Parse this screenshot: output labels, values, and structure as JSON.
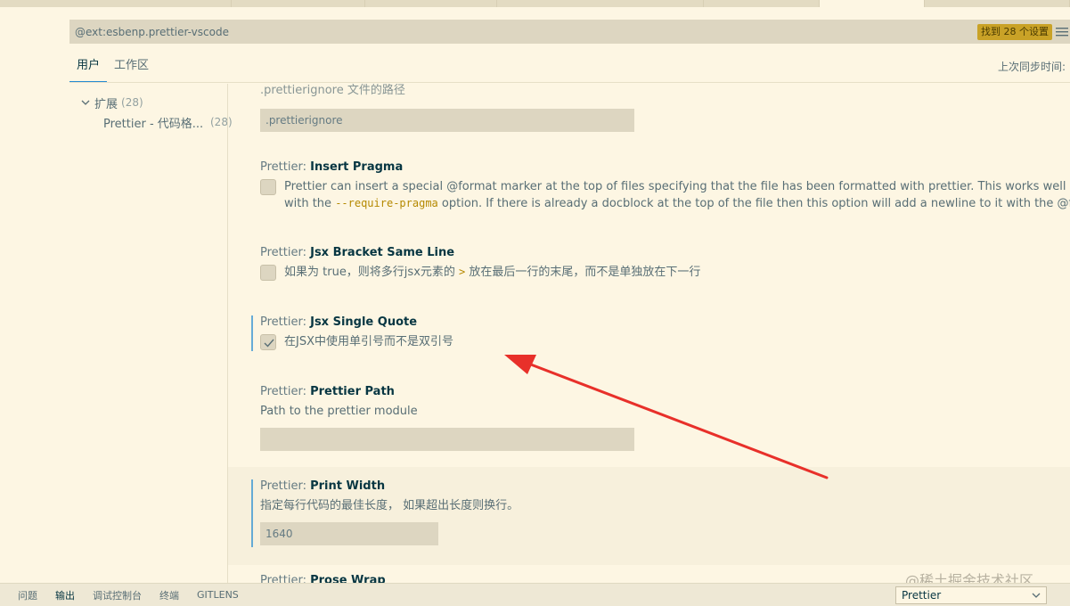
{
  "search": {
    "value": "@ext:esbenp.prettier-vscode",
    "result_count": "找到 28 个设置"
  },
  "scope_tabs": [
    "用户",
    "工作区"
  ],
  "sync_label": "上次同步时间:",
  "toc": {
    "group_label": "扩展",
    "group_count": "(28)",
    "item_label": "Prettier - 代码格...",
    "item_count": "(28)"
  },
  "settings": {
    "ignore_path": {
      "desc_partial": ".prettierignore 文件的路径",
      "value": ".prettierignore"
    },
    "insert_pragma": {
      "category": "Prettier: ",
      "name": "Insert Pragma",
      "desc_line1": "Prettier can insert a special @format marker at the top of files specifying that the file has been formatted with prettier. This works well when used in tandem",
      "desc_line2_pre": "with the ",
      "desc_line2_code": "--require-pragma",
      "desc_line2_post": " option. If there is already a docblock at the top of the file then this option will add a newline to it with the @format marker.",
      "checked": false
    },
    "jsx_bracket": {
      "category": "Prettier: ",
      "name": "Jsx Bracket Same Line",
      "desc_pre": "如果为 true，则将多行jsx元素的 ",
      "desc_code": ">",
      "desc_post": " 放在最后一行的末尾，而不是单独放在下一行",
      "checked": false
    },
    "jsx_single_quote": {
      "category": "Prettier: ",
      "name": "Jsx Single Quote",
      "desc": "在JSX中使用单引号而不是双引号",
      "checked": true
    },
    "prettier_path": {
      "category": "Prettier: ",
      "name": "Prettier Path",
      "desc": "Path to the prettier module",
      "value": ""
    },
    "print_width": {
      "category": "Prettier: ",
      "name": "Print Width",
      "desc": "指定每行代码的最佳长度， 如果超出长度则换行。",
      "value": "1640"
    },
    "prose_wrap": {
      "category": "Prettier: ",
      "name": "Prose Wrap"
    }
  },
  "panel": {
    "tabs": [
      "问题",
      "输出",
      "调试控制台",
      "终端",
      "GITLENS"
    ],
    "active_tab": "输出",
    "output_channel": "Prettier"
  },
  "watermark": "@稀土掘金技术社区",
  "colors": {
    "background": "#fdf6e3",
    "accent": "#268bd2",
    "badge": "#c9a227",
    "arrow": "#e8302a"
  }
}
